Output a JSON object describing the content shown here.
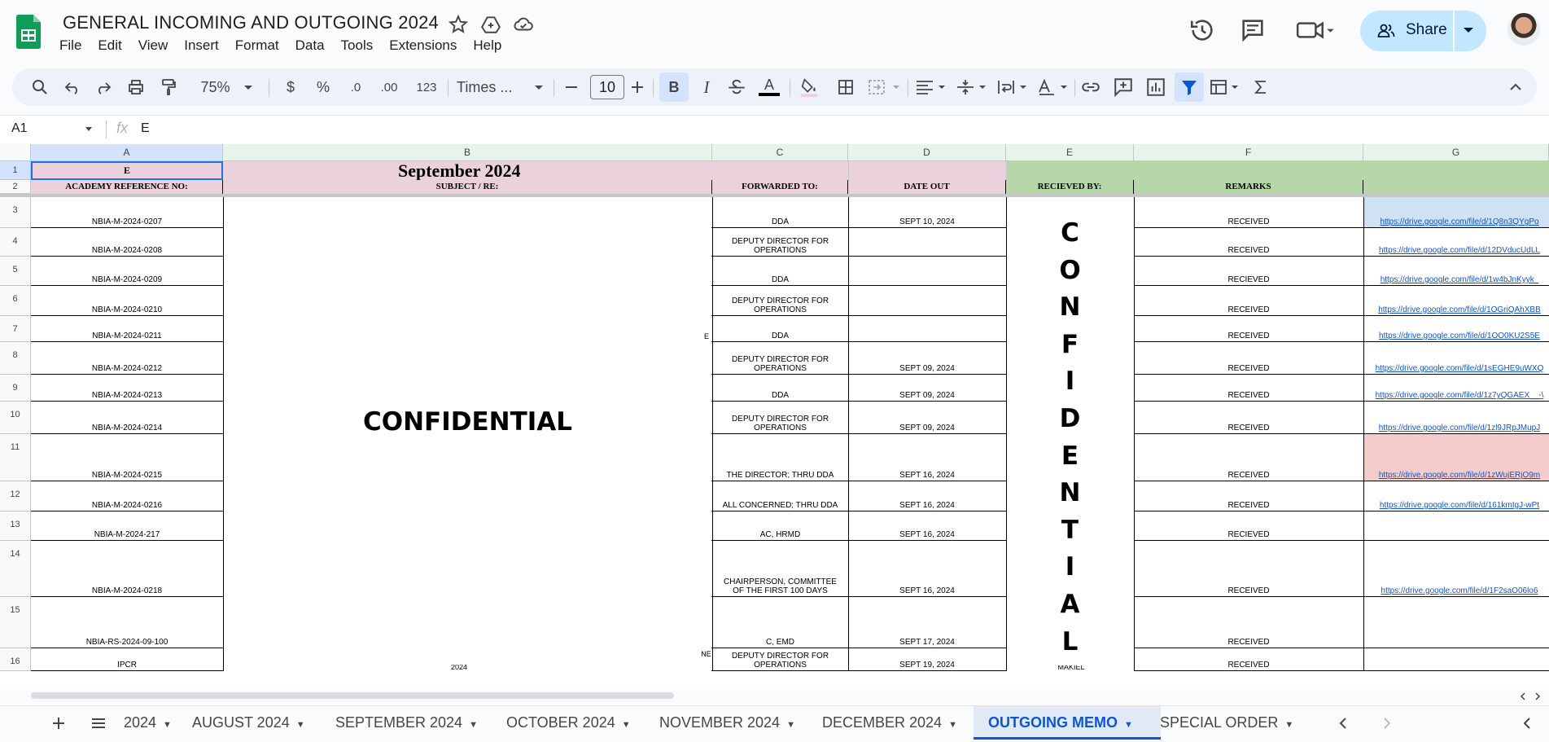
{
  "app": {
    "title": "GENERAL INCOMING AND OUTGOING 2024",
    "menu": [
      "File",
      "Edit",
      "View",
      "Insert",
      "Format",
      "Data",
      "Tools",
      "Extensions",
      "Help"
    ],
    "share_label": "Share"
  },
  "toolbar": {
    "zoom": "75%",
    "currency": "$",
    "percent": "%",
    "decimal_decrease": ".0",
    "decimal_increase": ".00",
    "number_format": "123",
    "font": "Times ...",
    "font_size": "10",
    "bold": "B",
    "italic": "I",
    "text_color": "A"
  },
  "formula_bar": {
    "cell_ref": "A1",
    "fx": "fx",
    "value": "E"
  },
  "columns": [
    "A",
    "B",
    "C",
    "D",
    "E",
    "F",
    "G"
  ],
  "sheet": {
    "row1": {
      "a": "E",
      "b": "September 2024"
    },
    "headers": {
      "a": "ACADEMY REFERENCE NO:",
      "b": "SUBJECT / RE:",
      "c": "FORWARDED TO:",
      "d": "DATE OUT",
      "e": "RECIEVED BY:",
      "f": "REMARKS"
    },
    "confidential_b": "CONFIDENTIAL",
    "confidential_e_letters": [
      "C",
      "O",
      "N",
      "F",
      "I",
      "D",
      "E",
      "N",
      "T",
      "I",
      "A",
      "L"
    ],
    "fragments": {
      "b7": "E",
      "b16_right": "NE",
      "b16_bottom": "2024",
      "e16_bottom": "MAKIEL"
    },
    "rows": [
      {
        "num": "3",
        "ref": "NBIA-M-2024-0207",
        "fwd": "DDA",
        "date": "SEPT 10, 2024",
        "remarks": "RECEIVED",
        "link": "https://drive.google.com/file/d/1Q8n3QYgPo"
      },
      {
        "num": "4",
        "ref": "NBIA-M-2024-0208",
        "fwd": "DEPUTY DIRECTOR FOR OPERATIONS",
        "date": "",
        "remarks": "RECEIVED",
        "link": "https://drive.google.com/file/d/12DVducUdLL"
      },
      {
        "num": "5",
        "ref": "NBIA-M-2024-0209",
        "fwd": "DDA",
        "date": "",
        "remarks": "RECIEVED",
        "link": "https://drive.google.com/file/d/1w4bJnKyyk_"
      },
      {
        "num": "6",
        "ref": "NBIA-M-2024-0210",
        "fwd": "DEPUTY DIRECTOR FOR OPERATIONS",
        "date": "",
        "remarks": "RECEIVED",
        "link": "https://drive.google.com/file/d/1OGriQAhXBB"
      },
      {
        "num": "7",
        "ref": "NBIA-M-2024-0211",
        "fwd": "DDA",
        "date": "",
        "remarks": "RECEIVED",
        "link": "https://drive.google.com/file/d/1OO0KU2S5E"
      },
      {
        "num": "8",
        "ref": "NBIA-M-2024-0212",
        "fwd": "DEPUTY DIRECTOR FOR OPERATIONS",
        "date": "SEPT 09, 2024",
        "remarks": "RECEIVED",
        "link": "https://drive.google.com/file/d/1sEGHE9uWXQ"
      },
      {
        "num": "9",
        "ref": "NBIA-M-2024-0213",
        "fwd": "DDA",
        "date": "SEPT 09, 2024",
        "remarks": "RECEIVED",
        "link": "https://drive.google.com/file/d/1z7yQGAEX__-\\"
      },
      {
        "num": "10",
        "ref": "NBIA-M-2024-0214",
        "fwd": "DEPUTY DIRECTOR FOR OPERATIONS",
        "date": "SEPT 09, 2024",
        "remarks": "RECEIVED",
        "link": "https://drive.google.com/file/d/1zl9JRpJMupJ"
      },
      {
        "num": "11",
        "ref": "NBIA-M-2024-0215",
        "fwd": "THE DIRECTOR; THRU DDA",
        "date": "SEPT 16, 2024",
        "remarks": "RECEIVED",
        "link": "https://drive.google.com/file/d/1zWujERjO9m"
      },
      {
        "num": "12",
        "ref": "NBIA-M-2024-0216",
        "fwd": "ALL CONCERNED; THRU DDA",
        "date": "SEPT 16, 2024",
        "remarks": "RECEIVED",
        "link": "https://drive.google.com/file/d/161kmIgJ-wPt"
      },
      {
        "num": "13",
        "ref": "NBIA-M-2024-217",
        "fwd": "AC, HRMD",
        "date": "SEPT 16, 2024",
        "remarks": "RECIEVED",
        "link": ""
      },
      {
        "num": "14",
        "ref": "NBIA-M-2024-0218",
        "fwd": "CHAIRPERSON, COMMITTEE OF THE FIRST 100 DAYS",
        "date": "SEPT 16, 2024",
        "remarks": "RECEIVED",
        "link": "https://drive.google.com/file/d/1F2saO06lo6"
      },
      {
        "num": "15",
        "ref": "NBIA-RS-2024-09-100",
        "fwd": "C, EMD",
        "date": "SEPT 17, 2024",
        "remarks": "RECEIVED",
        "link": ""
      },
      {
        "num": "16",
        "ref": "IPCR",
        "fwd": "DEPUTY DIRECTOR FOR OPERATIONS",
        "date": "SEPT 19, 2024",
        "remarks": "RECEIVED",
        "link": ""
      }
    ]
  },
  "tabs": [
    "2024",
    "AUGUST 2024",
    "SEPTEMBER 2024",
    "OCTOBER 2024",
    "NOVEMBER 2024",
    "DECEMBER 2024",
    "OUTGOING MEMO",
    "SPECIAL ORDER"
  ],
  "active_tab": "OUTGOING MEMO",
  "colors": {
    "pink": "#ead1dc",
    "green": "#b6d7a8",
    "blue_cell": "#cfe2f3",
    "pink_cell": "#f4cccc"
  }
}
